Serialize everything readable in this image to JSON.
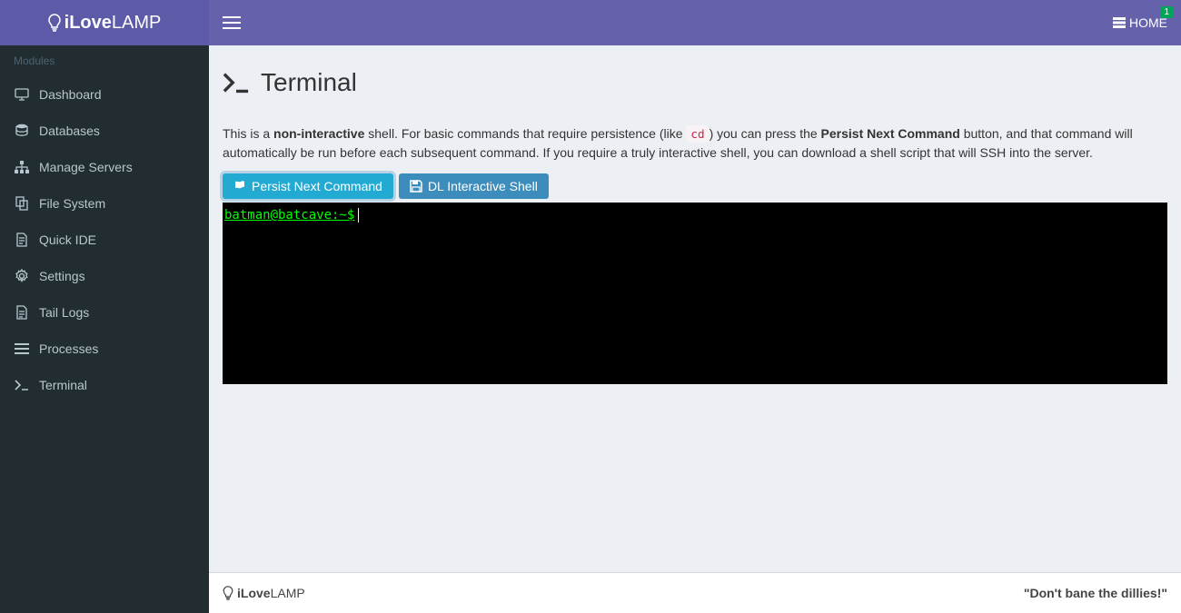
{
  "brand": {
    "light": "iLove",
    "bold": "LAMP"
  },
  "header": {
    "home_label": "HOME",
    "home_badge": "1"
  },
  "sidebar": {
    "section": "Modules",
    "items": [
      {
        "icon": "monitor-icon",
        "label": "Dashboard"
      },
      {
        "icon": "database-icon",
        "label": "Databases"
      },
      {
        "icon": "sitemap-icon",
        "label": "Manage Servers"
      },
      {
        "icon": "copy-icon",
        "label": "File System"
      },
      {
        "icon": "file-text-icon",
        "label": "Quick IDE"
      },
      {
        "icon": "gear-icon",
        "label": "Settings"
      },
      {
        "icon": "file-icon",
        "label": "Tail Logs"
      },
      {
        "icon": "list-icon",
        "label": "Processes"
      },
      {
        "icon": "terminal-icon",
        "label": "Terminal"
      }
    ]
  },
  "page": {
    "title": "Terminal",
    "description": {
      "prefix": "This is a ",
      "bold1": "non-interactive",
      "mid1": " shell. For basic commands that require persistence (like ",
      "code": "cd",
      "mid2": ") you can press the ",
      "bold2": "Persist Next Command",
      "suffix": " button, and that command will automatically be run before each subsequent command. If you require a truly interactive shell, you can download a shell script that will SSH into the server."
    },
    "buttons": {
      "persist": "Persist Next Command",
      "download": "DL Interactive Shell"
    },
    "terminal": {
      "prompt": "batman@batcave:~$",
      "input_value": ""
    }
  },
  "footer": {
    "brand_light": "iLove",
    "brand_bold": "LAMP",
    "quote": "\"Don't bane the dillies!\""
  }
}
